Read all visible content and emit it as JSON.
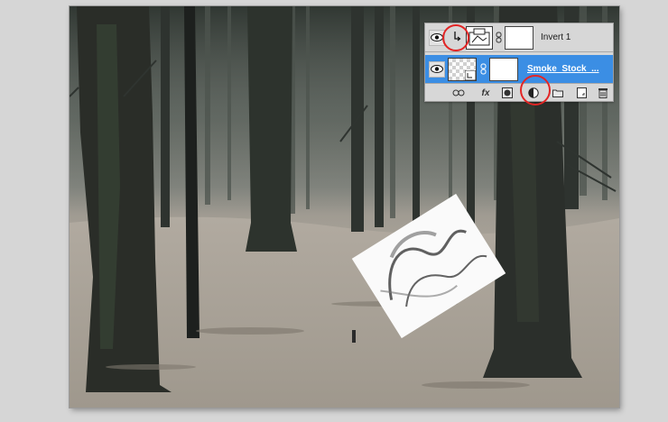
{
  "layers_panel": {
    "layers": [
      {
        "name": "Invert 1",
        "type": "adjustment",
        "visible": true,
        "clipped": true,
        "selected": false
      },
      {
        "name": "Smoke_Stock_...",
        "type": "smart-object",
        "visible": true,
        "clipped": false,
        "selected": true
      }
    ],
    "bottom_bar": [
      "link-layers-icon",
      "fx-icon",
      "add-mask-icon",
      "adjustment-layer-icon",
      "new-group-icon",
      "new-layer-icon",
      "trash-icon"
    ],
    "fx_label": "fx",
    "selection_color": "#3b8ee4",
    "highlight_color": "#e32525"
  },
  "canvas": {
    "scene": "misty winter forest with dark tree trunks and a rotated smoke stock image"
  }
}
